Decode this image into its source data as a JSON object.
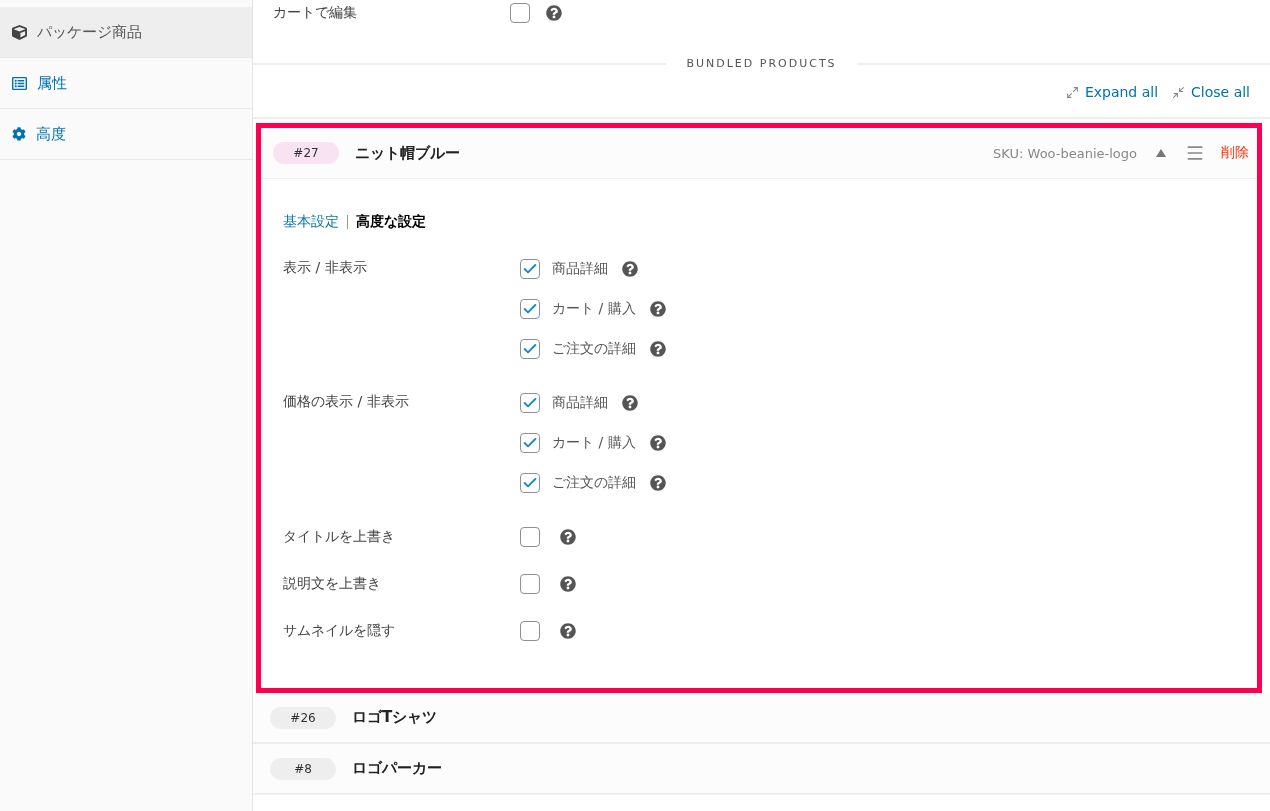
{
  "sidebar": {
    "items": [
      {
        "kind": "package",
        "label": "パッケージ商品",
        "selected": true
      },
      {
        "kind": "attributes",
        "label": "属性",
        "selected": false
      },
      {
        "kind": "advanced",
        "label": "高度",
        "selected": false
      }
    ]
  },
  "top_option": {
    "label": "カートで編集",
    "checked": false
  },
  "section_title": "BUNDLED PRODUCTS",
  "actions": [
    {
      "kind": "expand",
      "label": "Expand all"
    },
    {
      "kind": "close",
      "label": "Close all"
    }
  ],
  "products": [
    {
      "id": "#27",
      "name": "ニット帽ブルー",
      "expanded": true,
      "highlighted": true,
      "sku": "SKU: Woo-beanie-logo",
      "delete_label": "削除",
      "tabs": [
        {
          "label": "基本設定",
          "selected": false
        },
        {
          "label": "高度な設定",
          "selected": true
        }
      ],
      "options": [
        {
          "kind": "group",
          "label": "表示 / 非表示",
          "choices": [
            {
              "label": "商品詳細",
              "checked": true
            },
            {
              "label": "カート / 購入",
              "checked": true
            },
            {
              "label": "ご注文の詳細",
              "checked": true
            }
          ]
        },
        {
          "kind": "group",
          "label": "価格の表示 / 非表示",
          "choices": [
            {
              "label": "商品詳細",
              "checked": true
            },
            {
              "label": "カート / 購入",
              "checked": true
            },
            {
              "label": "ご注文の詳細",
              "checked": true
            }
          ]
        },
        {
          "kind": "single",
          "label": "タイトルを上書き",
          "checked": false
        },
        {
          "kind": "single",
          "label": "説明文を上書き",
          "checked": false
        },
        {
          "kind": "single",
          "label": "サムネイルを隠す",
          "checked": false
        }
      ]
    },
    {
      "id": "#26",
      "name": "ロゴTシャツ",
      "expanded": false,
      "highlighted": false
    },
    {
      "id": "#8",
      "name": "ロゴパーカー",
      "expanded": false,
      "highlighted": false
    }
  ]
}
